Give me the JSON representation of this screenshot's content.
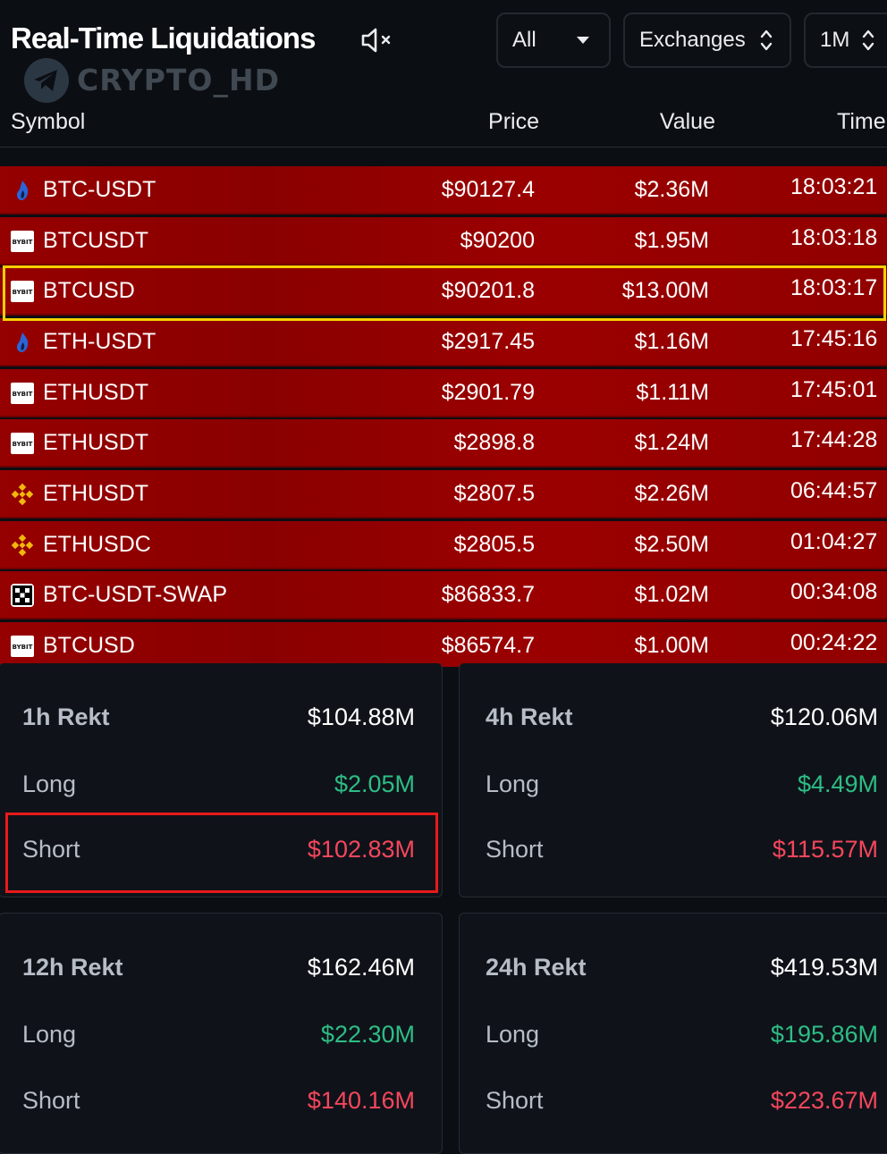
{
  "header": {
    "title": "Real-Time Liquidations",
    "watermark": "CRYPTO_HD",
    "filter_all": "All",
    "filter_exchanges": "Exchanges",
    "filter_range": "1M"
  },
  "columns": {
    "symbol": "Symbol",
    "price": "Price",
    "value": "Value",
    "time": "Time"
  },
  "rows": [
    {
      "exchange_icon": "huobi-icon",
      "symbol": "BTC-USDT",
      "price": "$90127.4",
      "value": "$2.36M",
      "time": "18:03:21"
    },
    {
      "exchange_icon": "bybit-icon",
      "symbol": "BTCUSDT",
      "price": "$90200",
      "value": "$1.95M",
      "time": "18:03:18"
    },
    {
      "exchange_icon": "bybit-icon",
      "symbol": "BTCUSD",
      "price": "$90201.8",
      "value": "$13.00M",
      "time": "18:03:17"
    },
    {
      "exchange_icon": "huobi-icon",
      "symbol": "ETH-USDT",
      "price": "$2917.45",
      "value": "$1.16M",
      "time": "17:45:16"
    },
    {
      "exchange_icon": "bybit-icon",
      "symbol": "ETHUSDT",
      "price": "$2901.79",
      "value": "$1.11M",
      "time": "17:45:01"
    },
    {
      "exchange_icon": "bybit-icon",
      "symbol": "ETHUSDT",
      "price": "$2898.8",
      "value": "$1.24M",
      "time": "17:44:28"
    },
    {
      "exchange_icon": "binance-icon",
      "symbol": "ETHUSDT",
      "price": "$2807.5",
      "value": "$2.26M",
      "time": "06:44:57"
    },
    {
      "exchange_icon": "binance-icon",
      "symbol": "ETHUSDC",
      "price": "$2805.5",
      "value": "$2.50M",
      "time": "01:04:27"
    },
    {
      "exchange_icon": "okx-icon",
      "symbol": "BTC-USDT-SWAP",
      "price": "$86833.7",
      "value": "$1.02M",
      "time": "00:34:08"
    },
    {
      "exchange_icon": "bybit-icon",
      "symbol": "BTCUSD",
      "price": "$86574.7",
      "value": "$1.00M",
      "time": "00:24:22"
    }
  ],
  "stats": {
    "h1": {
      "title": "1h Rekt",
      "total": "$104.88M",
      "long_label": "Long",
      "long": "$2.05M",
      "short_label": "Short",
      "short": "$102.83M"
    },
    "h4": {
      "title": "4h Rekt",
      "total": "$120.06M",
      "long_label": "Long",
      "long": "$4.49M",
      "short_label": "Short",
      "short": "$115.57M"
    },
    "h12": {
      "title": "12h Rekt",
      "total": "$162.46M",
      "long_label": "Long",
      "long": "$22.30M",
      "short_label": "Short",
      "short": "$140.16M"
    },
    "h24": {
      "title": "24h Rekt",
      "total": "$419.53M",
      "long_label": "Long",
      "long": "$195.86M",
      "short_label": "Short",
      "short": "$223.67M"
    }
  },
  "colors": {
    "row_red": "#950000",
    "long_green": "#2ebd85",
    "short_red": "#f6465d",
    "highlight_yellow": "#f6d000",
    "highlight_red": "#e81a1a"
  }
}
